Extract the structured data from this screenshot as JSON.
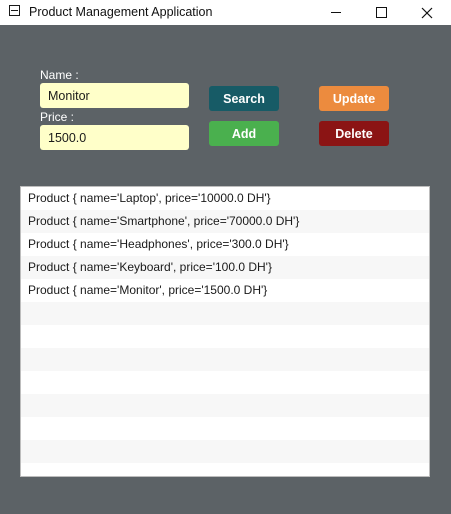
{
  "window": {
    "title": "Product Management Application"
  },
  "form": {
    "name_label": "Name :",
    "name_value": "Monitor",
    "price_label": "Price :",
    "price_value": "1500.0"
  },
  "buttons": {
    "search": "Search",
    "add": "Add",
    "update": "Update",
    "delete": "Delete"
  },
  "colors": {
    "background": "#5c6266",
    "field": "#ffffc9",
    "search": "#175b66",
    "add": "#4ab04e",
    "update": "#ec8b3e",
    "delete": "#8b1414"
  },
  "product_list": {
    "items": [
      "Product { name='Laptop', price='10000.0 DH'}",
      "Product { name='Smartphone', price='70000.0 DH'}",
      "Product { name='Headphones', price='300.0 DH'}",
      "Product { name='Keyboard', price='100.0 DH'}",
      "Product { name='Monitor', price='1500.0 DH'}",
      "",
      "",
      "",
      "",
      "",
      "",
      "",
      ""
    ]
  }
}
